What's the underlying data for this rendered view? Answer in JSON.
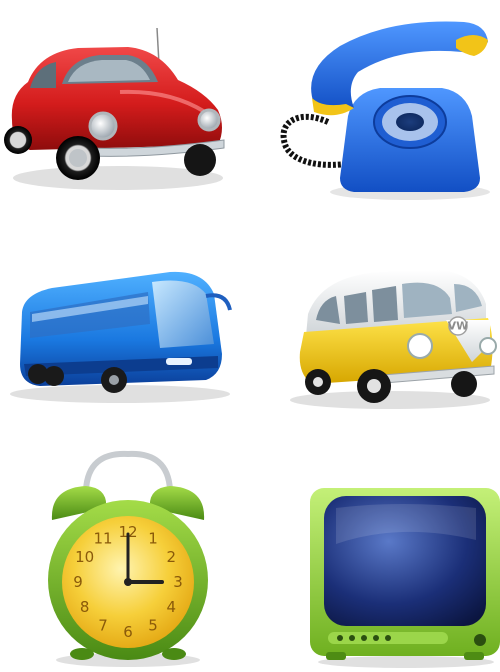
{
  "icons": [
    {
      "id": "car",
      "name": "red-beetle-car-icon"
    },
    {
      "id": "phone",
      "name": "blue-rotary-telephone-icon"
    },
    {
      "id": "bus",
      "name": "blue-bus-icon"
    },
    {
      "id": "van",
      "name": "yellow-vw-van-icon"
    },
    {
      "id": "clock",
      "name": "green-alarm-clock-icon"
    },
    {
      "id": "tv",
      "name": "green-retro-tv-icon"
    }
  ],
  "clock": {
    "numbers": [
      "12",
      "1",
      "2",
      "3",
      "4",
      "5",
      "6",
      "7",
      "8",
      "9",
      "10",
      "11"
    ],
    "hours": 3,
    "minutes": 0
  },
  "van": {
    "logo": "VW"
  },
  "colors": {
    "car": "#d42020",
    "phone": "#1f64d8",
    "phone_accent": "#f2c418",
    "bus": "#1a78e0",
    "van": "#f2c800",
    "clock_body": "#6fae20",
    "clock_face": "#f6cf3a",
    "tv_frame": "#8fd23a",
    "tv_screen": "#1b2f78"
  }
}
